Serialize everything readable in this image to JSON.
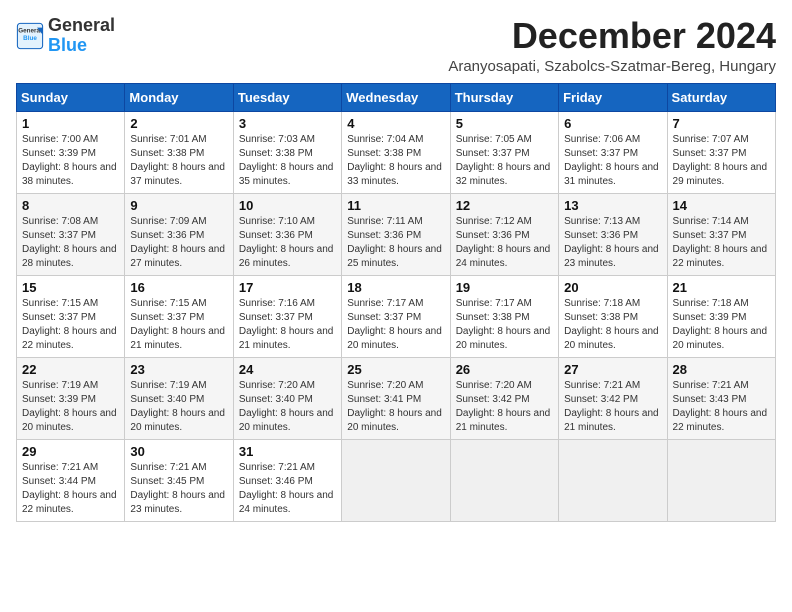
{
  "header": {
    "logo": {
      "general": "General",
      "blue": "Blue"
    },
    "title": "December 2024",
    "location": "Aranyosapati, Szabolcs-Szatmar-Bereg, Hungary"
  },
  "weekdays": [
    "Sunday",
    "Monday",
    "Tuesday",
    "Wednesday",
    "Thursday",
    "Friday",
    "Saturday"
  ],
  "weeks": [
    [
      {
        "day": "1",
        "sunrise": "7:00 AM",
        "sunset": "3:39 PM",
        "daylight": "8 hours and 38 minutes."
      },
      {
        "day": "2",
        "sunrise": "7:01 AM",
        "sunset": "3:38 PM",
        "daylight": "8 hours and 37 minutes."
      },
      {
        "day": "3",
        "sunrise": "7:03 AM",
        "sunset": "3:38 PM",
        "daylight": "8 hours and 35 minutes."
      },
      {
        "day": "4",
        "sunrise": "7:04 AM",
        "sunset": "3:38 PM",
        "daylight": "8 hours and 33 minutes."
      },
      {
        "day": "5",
        "sunrise": "7:05 AM",
        "sunset": "3:37 PM",
        "daylight": "8 hours and 32 minutes."
      },
      {
        "day": "6",
        "sunrise": "7:06 AM",
        "sunset": "3:37 PM",
        "daylight": "8 hours and 31 minutes."
      },
      {
        "day": "7",
        "sunrise": "7:07 AM",
        "sunset": "3:37 PM",
        "daylight": "8 hours and 29 minutes."
      }
    ],
    [
      {
        "day": "8",
        "sunrise": "7:08 AM",
        "sunset": "3:37 PM",
        "daylight": "8 hours and 28 minutes."
      },
      {
        "day": "9",
        "sunrise": "7:09 AM",
        "sunset": "3:36 PM",
        "daylight": "8 hours and 27 minutes."
      },
      {
        "day": "10",
        "sunrise": "7:10 AM",
        "sunset": "3:36 PM",
        "daylight": "8 hours and 26 minutes."
      },
      {
        "day": "11",
        "sunrise": "7:11 AM",
        "sunset": "3:36 PM",
        "daylight": "8 hours and 25 minutes."
      },
      {
        "day": "12",
        "sunrise": "7:12 AM",
        "sunset": "3:36 PM",
        "daylight": "8 hours and 24 minutes."
      },
      {
        "day": "13",
        "sunrise": "7:13 AM",
        "sunset": "3:36 PM",
        "daylight": "8 hours and 23 minutes."
      },
      {
        "day": "14",
        "sunrise": "7:14 AM",
        "sunset": "3:37 PM",
        "daylight": "8 hours and 22 minutes."
      }
    ],
    [
      {
        "day": "15",
        "sunrise": "7:15 AM",
        "sunset": "3:37 PM",
        "daylight": "8 hours and 22 minutes."
      },
      {
        "day": "16",
        "sunrise": "7:15 AM",
        "sunset": "3:37 PM",
        "daylight": "8 hours and 21 minutes."
      },
      {
        "day": "17",
        "sunrise": "7:16 AM",
        "sunset": "3:37 PM",
        "daylight": "8 hours and 21 minutes."
      },
      {
        "day": "18",
        "sunrise": "7:17 AM",
        "sunset": "3:37 PM",
        "daylight": "8 hours and 20 minutes."
      },
      {
        "day": "19",
        "sunrise": "7:17 AM",
        "sunset": "3:38 PM",
        "daylight": "8 hours and 20 minutes."
      },
      {
        "day": "20",
        "sunrise": "7:18 AM",
        "sunset": "3:38 PM",
        "daylight": "8 hours and 20 minutes."
      },
      {
        "day": "21",
        "sunrise": "7:18 AM",
        "sunset": "3:39 PM",
        "daylight": "8 hours and 20 minutes."
      }
    ],
    [
      {
        "day": "22",
        "sunrise": "7:19 AM",
        "sunset": "3:39 PM",
        "daylight": "8 hours and 20 minutes."
      },
      {
        "day": "23",
        "sunrise": "7:19 AM",
        "sunset": "3:40 PM",
        "daylight": "8 hours and 20 minutes."
      },
      {
        "day": "24",
        "sunrise": "7:20 AM",
        "sunset": "3:40 PM",
        "daylight": "8 hours and 20 minutes."
      },
      {
        "day": "25",
        "sunrise": "7:20 AM",
        "sunset": "3:41 PM",
        "daylight": "8 hours and 20 minutes."
      },
      {
        "day": "26",
        "sunrise": "7:20 AM",
        "sunset": "3:42 PM",
        "daylight": "8 hours and 21 minutes."
      },
      {
        "day": "27",
        "sunrise": "7:21 AM",
        "sunset": "3:42 PM",
        "daylight": "8 hours and 21 minutes."
      },
      {
        "day": "28",
        "sunrise": "7:21 AM",
        "sunset": "3:43 PM",
        "daylight": "8 hours and 22 minutes."
      }
    ],
    [
      {
        "day": "29",
        "sunrise": "7:21 AM",
        "sunset": "3:44 PM",
        "daylight": "8 hours and 22 minutes."
      },
      {
        "day": "30",
        "sunrise": "7:21 AM",
        "sunset": "3:45 PM",
        "daylight": "8 hours and 23 minutes."
      },
      {
        "day": "31",
        "sunrise": "7:21 AM",
        "sunset": "3:46 PM",
        "daylight": "8 hours and 24 minutes."
      },
      null,
      null,
      null,
      null
    ]
  ],
  "labels": {
    "sunrise": "Sunrise:",
    "sunset": "Sunset:",
    "daylight": "Daylight hours"
  }
}
